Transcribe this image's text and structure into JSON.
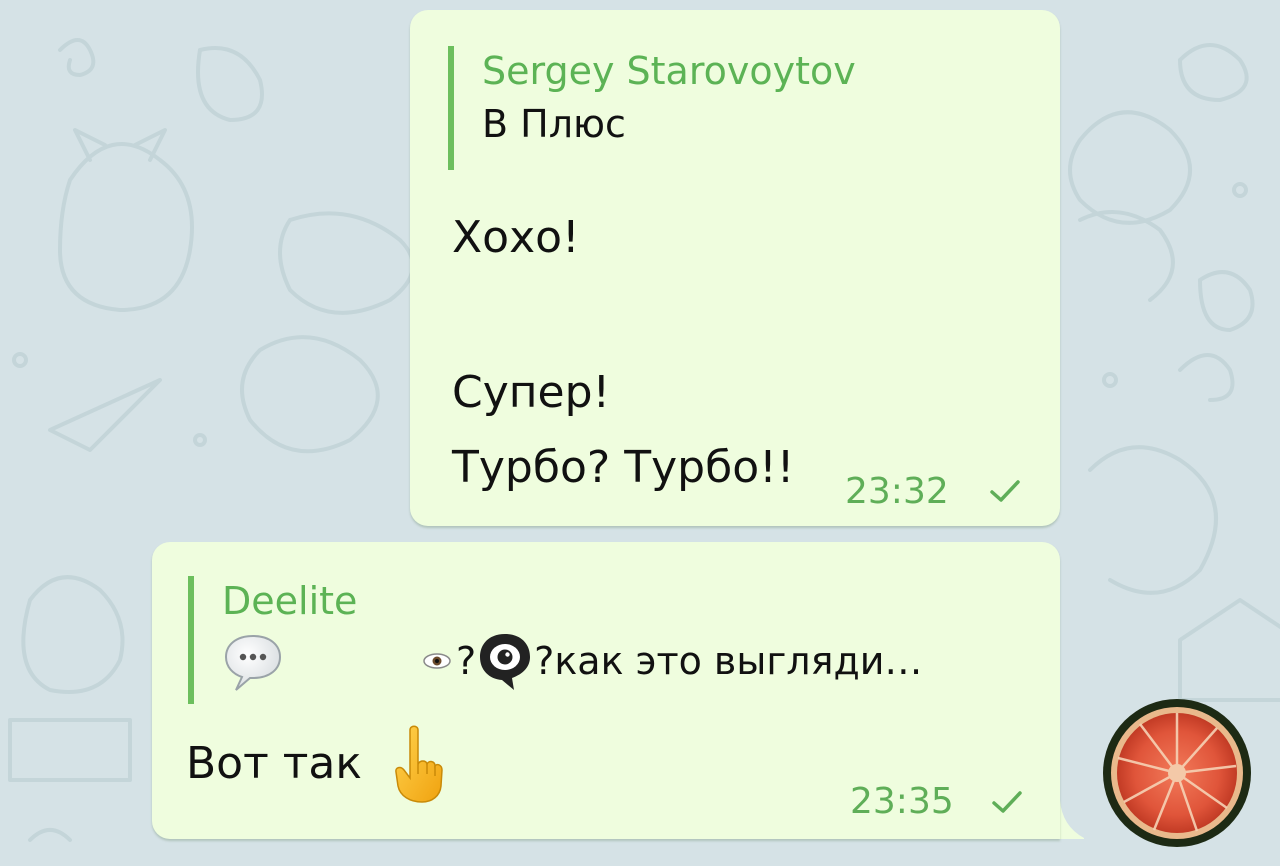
{
  "colors": {
    "background": "#d5e2e6",
    "bubble": "#effdde",
    "accent_green": "#5cb355",
    "reply_bar": "#6cbf5d",
    "text": "#111111"
  },
  "messages": [
    {
      "reply": {
        "name": "Sergey Starovoytov",
        "text": "В Плюс"
      },
      "lines": [
        "Хохо!",
        "Супер!",
        "Турбо? Турбо!!"
      ],
      "time": "23:32",
      "status_icon": "single-check-icon"
    },
    {
      "reply": {
        "name": "Deelite",
        "icon": "speech-bubble-icon",
        "snippet_prefix": "?",
        "snippet_middle": "?",
        "snippet_text": " как это выгляди…"
      },
      "text": "Вот так",
      "emoji": "pointing-up-icon",
      "time": "23:35",
      "status_icon": "single-check-icon"
    }
  ],
  "avatar": {
    "icon": "grapefruit-slice-avatar"
  }
}
